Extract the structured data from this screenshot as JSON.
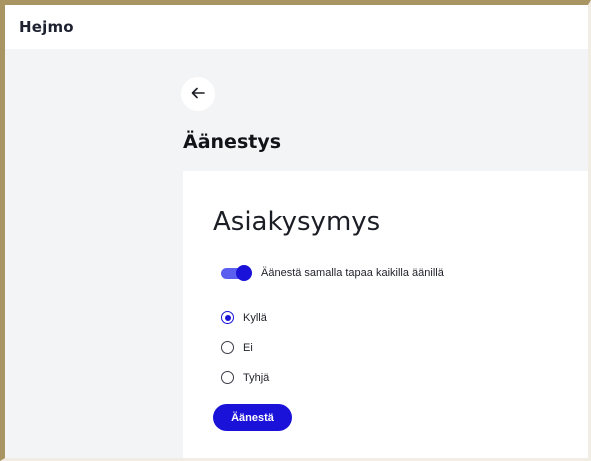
{
  "app": {
    "brand": "Hejmo"
  },
  "page": {
    "title": "Äänestys"
  },
  "card": {
    "title": "Asiakysymys",
    "toggle": {
      "label": "Äänestä samalla tapaa kaikilla äänillä",
      "checked": true
    },
    "options": [
      {
        "label": "Kyllä",
        "checked": true
      },
      {
        "label": "Ei",
        "checked": false
      },
      {
        "label": "Tyhjä",
        "checked": false
      }
    ],
    "vote_label": "Äänestä"
  },
  "colors": {
    "accent": "#1a12d9",
    "background": "#f3f4f6",
    "frame": "#a89563"
  },
  "icons": {
    "back": "arrow-left-icon"
  }
}
